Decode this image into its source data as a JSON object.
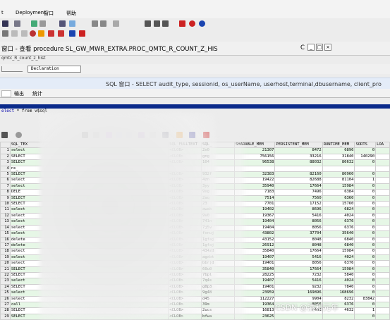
{
  "menu": [
    "t",
    "Deployment",
    "窗口",
    "帮助"
  ],
  "proc_window": {
    "title": "窗口 - 查看 procedure SL_GW_MWR_EXTRA.PROC_QMTC_R_COUNT_Z_HIS",
    "tail": "C",
    "sub": "qmtc_R_count_z_hist",
    "declaration": "Declaration"
  },
  "sql_window": {
    "title": "SQL 窗口 - SELECT audit_type, sessionid, os_userName, userhost,terminal,dbusername, client_pro"
  },
  "tabs": [
    "",
    "输出",
    "统计"
  ],
  "sql_text": {
    "prefix": "elect",
    "rest": " * from v$sql"
  },
  "columns": [
    "",
    "SQL_TEX",
    "SQL_FULLTEXT",
    "SQL_",
    "SHARABLE_MEM",
    "PERSISTENT_MEM",
    "RUNTIME_MEM",
    "SORTS",
    "LOA"
  ],
  "rows": [
    [
      "1",
      "select",
      "<CLOB>",
      "2x0",
      "21307",
      "8472",
      "6896",
      "0",
      ""
    ],
    [
      "2",
      "SELECT",
      "<CLOB>",
      "gng",
      "756156",
      "33216",
      "31840",
      "140290",
      ""
    ],
    [
      "3",
      "SELECT",
      "<CLOB>",
      "104",
      "96538",
      "88032",
      "86632",
      "0",
      ""
    ],
    [
      "4",
      "ns_",
      "",
      "",
      "",
      "",
      "",
      "",
      ""
    ],
    [
      "5",
      "SELECT",
      "<CLOB>",
      "932f",
      "32383",
      "82160",
      "80960",
      "0",
      ""
    ],
    [
      "6",
      "select",
      "<CLOB>",
      "4zn",
      "19422",
      "82688",
      "81104",
      "1",
      ""
    ],
    [
      "7",
      "select",
      "<CLOB>",
      "3yy",
      "35940",
      "17664",
      "15984",
      "0",
      ""
    ],
    [
      "8",
      "DELE",
      "<CLOB>",
      "9xg",
      "7183",
      "7496",
      "6384",
      "0",
      ""
    ],
    [
      "9",
      "SELECT",
      "<CLOB>",
      "2aq",
      "7514",
      "7560",
      "6360",
      "0",
      ""
    ],
    [
      "10",
      "SELECT",
      "<CLOB>",
      "23",
      "7701",
      "17152",
      "15760",
      "0",
      ""
    ],
    [
      "11",
      "select",
      "<CLOB>",
      "awak",
      "19402",
      "8696",
      "6824",
      "0",
      ""
    ],
    [
      "12",
      "select",
      "<CLOB>",
      "9v0",
      "19367",
      "5416",
      "4024",
      "0",
      ""
    ],
    [
      "13",
      "select",
      "<CLOB>",
      "741n",
      "19404",
      "8056",
      "6376",
      "0",
      ""
    ],
    [
      "14",
      "select",
      "<CLOB>",
      "7j5v",
      "19404",
      "8056",
      "6376",
      "0",
      ""
    ],
    [
      "15",
      "select",
      "<CLOB>",
      "fxnuj",
      "43802",
      "37704",
      "35640",
      "0",
      ""
    ],
    [
      "16",
      "delete",
      "<CLOB>",
      "1gfaj",
      "43152",
      "8048",
      "6840",
      "0",
      ""
    ],
    [
      "17",
      "delete",
      "<CLOB>",
      "1gfaj",
      "26912",
      "8048",
      "6840",
      "0",
      ""
    ],
    [
      "18",
      "select",
      "<CLOB>",
      "434zd",
      "35840",
      "17664",
      "15984",
      "0",
      ""
    ],
    [
      "19",
      "select",
      "<CLOB>",
      "agxbt",
      "19407",
      "5416",
      "4024",
      "0",
      ""
    ],
    [
      "20",
      "select",
      "<CLOB>",
      "bbrjd",
      "19401",
      "8056",
      "6376",
      "0",
      ""
    ],
    [
      "21",
      "SELECT",
      "<CLOB>",
      "60u0",
      "35840",
      "17664",
      "15984",
      "0",
      ""
    ],
    [
      "22",
      "SELECT",
      "<CLOB>",
      "7bpl",
      "28225",
      "7232",
      "5840",
      "0",
      ""
    ],
    [
      "23",
      "select",
      "<CLOB>",
      "7q4s",
      "19407",
      "5416",
      "4024",
      "0",
      ""
    ],
    [
      "24",
      "SELECT",
      "<CLOB>",
      "g0p3",
      "19401",
      "9232",
      "7840",
      "0",
      ""
    ],
    [
      "25",
      "select",
      "<CLOB>",
      "9g48",
      "23959",
      "169896",
      "168696",
      "0",
      ""
    ],
    [
      "26",
      "select",
      "<CLOB>",
      "d45",
      "112227",
      "9904",
      "8232",
      "83842",
      ""
    ],
    [
      "27",
      "call",
      "<CLOB>",
      "39m",
      "19364",
      "8056",
      "6376",
      "0",
      ""
    ],
    [
      "28",
      "SELECT",
      "<CLOB>",
      "2ucs",
      "16813",
      "6408",
      "4632",
      "1",
      ""
    ],
    [
      "29",
      "SELECT",
      "<CLOB>",
      "bfwa",
      "23625",
      "",
      "",
      "0",
      ""
    ]
  ],
  "watermark": "CSDN @清和元年"
}
